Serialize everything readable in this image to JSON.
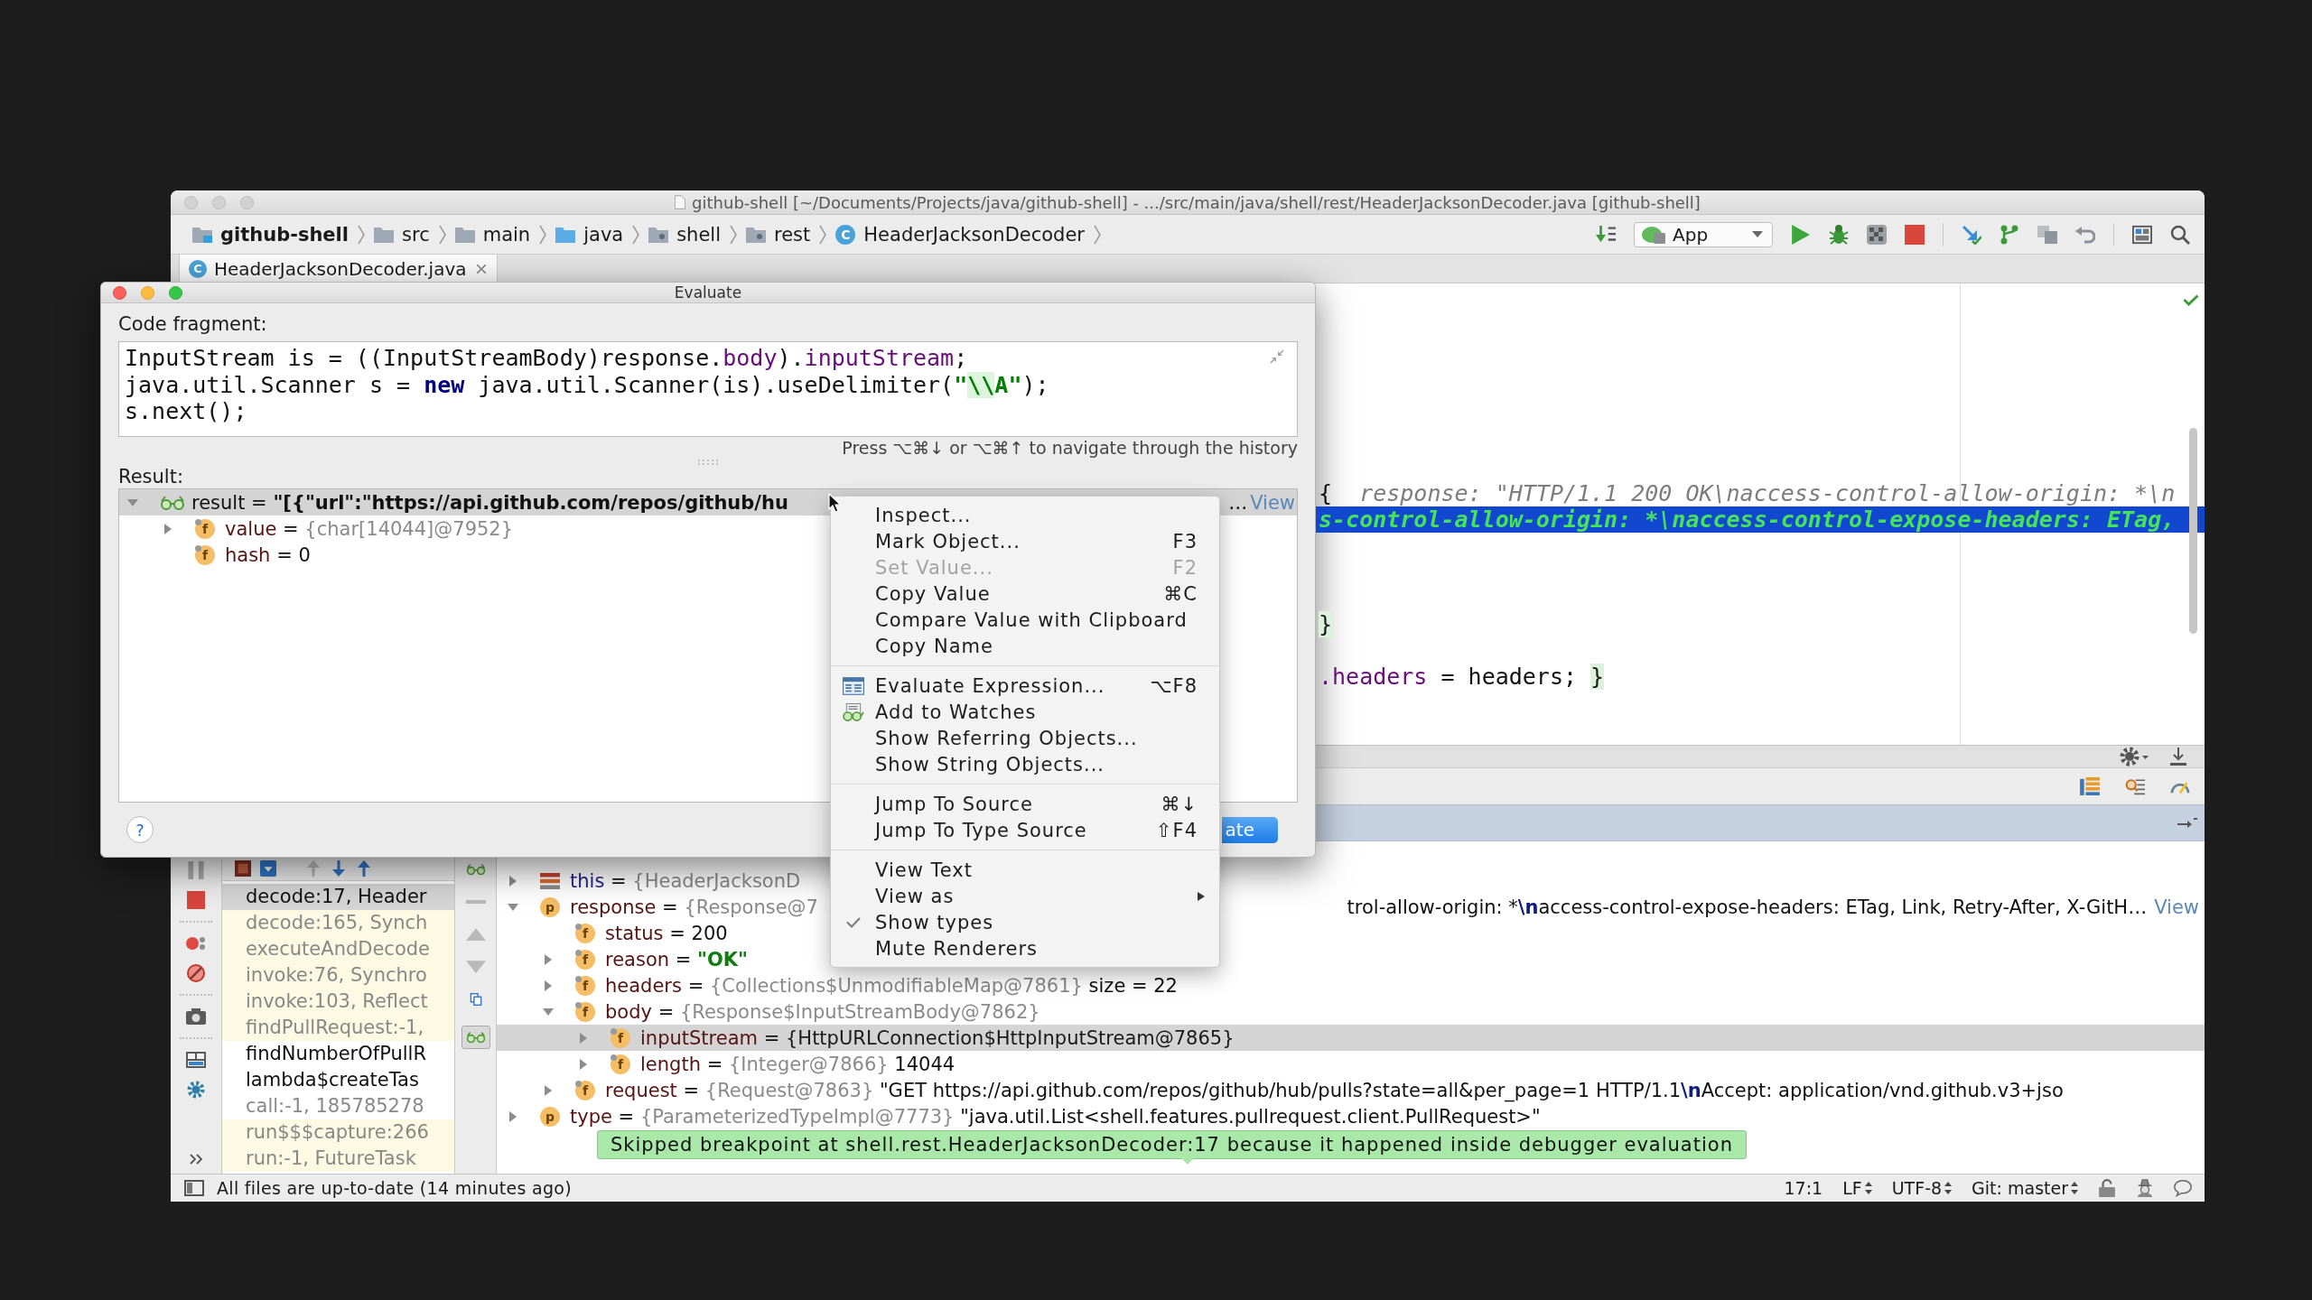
{
  "window": {
    "title": "github-shell [~/Documents/Projects/java/github-shell] - .../src/main/java/shell/rest/HeaderJacksonDecoder.java [github-shell]"
  },
  "navigation_bar": {
    "breadcrumbs": [
      {
        "label": "github-shell",
        "kind": "project"
      },
      {
        "label": "src",
        "kind": "folder"
      },
      {
        "label": "main",
        "kind": "folder"
      },
      {
        "label": "java",
        "kind": "source-root"
      },
      {
        "label": "shell",
        "kind": "package"
      },
      {
        "label": "rest",
        "kind": "package"
      },
      {
        "label": "HeaderJacksonDecoder",
        "kind": "class",
        "icon_letter": "C"
      }
    ],
    "run_configuration": "App"
  },
  "tabs": [
    {
      "label": "HeaderJacksonDecoder.java",
      "icon_letter": "C",
      "selected": true
    }
  ],
  "editor": {
    "lines": [
      {
        "current": false,
        "tokens": [
          {
            "text": "{",
            "kind": "plain"
          },
          {
            "text": "  response: \"HTTP/1.1 200 OK\\naccess-control-allow-origin: *\\n",
            "kind": "hint"
          }
        ]
      },
      {
        "current": true,
        "tokens": [
          {
            "text": "s-control-allow-origin: *\\naccess-control-expose-headers: ETag,",
            "kind": "hint"
          }
        ]
      },
      {
        "current": false,
        "tokens": [
          {
            "text": "}",
            "kind": "match"
          }
        ]
      },
      {
        "current": false,
        "tokens": [
          {
            "text": ".headers",
            "kind": "field"
          },
          {
            "text": " = headers; ",
            "kind": "plain"
          },
          {
            "text": "}",
            "kind": "match"
          }
        ]
      }
    ]
  },
  "evaluate_dialog": {
    "title": "Evaluate",
    "code_label": "Code fragment:",
    "code_lines": [
      {
        "tokens": [
          {
            "text": "InputStream is = ((InputStreamBody)response.",
            "kind": "plain"
          },
          {
            "text": "body",
            "kind": "field"
          },
          {
            "text": ").",
            "kind": "plain"
          },
          {
            "text": "inputStream",
            "kind": "field"
          },
          {
            "text": ";",
            "kind": "plain"
          }
        ]
      },
      {
        "tokens": [
          {
            "text": "java.util.Scanner s = ",
            "kind": "plain"
          },
          {
            "text": "new",
            "kind": "keyword"
          },
          {
            "text": " java.util.Scanner(is).useDelimiter(",
            "kind": "plain"
          },
          {
            "text": "\"",
            "kind": "string"
          },
          {
            "text": "\\\\",
            "kind": "escape"
          },
          {
            "text": "A\"",
            "kind": "string"
          },
          {
            "text": ");",
            "kind": "plain"
          }
        ]
      },
      {
        "tokens": [
          {
            "text": "s.next();",
            "kind": "plain"
          }
        ]
      }
    ],
    "history_hint": "Press ⌥⌘↓ or ⌥⌘↑ to navigate through the history",
    "result_label": "Result:",
    "result_tree": [
      {
        "name": "result",
        "operator": "=",
        "kind": "watch",
        "value": [
          {
            "text": "\"[{\"url\":\"https://api.github.com/repos/github/hu",
            "kind": "strong"
          }
        ],
        "tail": [
          {
            "text": "…",
            "kind": "plain"
          }
        ],
        "link": "View",
        "expandable": true,
        "expanded": true,
        "selected": true,
        "children": [
          {
            "name": "value",
            "operator": "=",
            "kind": "field",
            "icon_letter": "f",
            "type": "{char[14044]@7952}",
            "expandable": true,
            "expanded": false,
            "selected": false
          },
          {
            "name": "hash",
            "operator": "=",
            "kind": "field",
            "icon_letter": "f",
            "value": [
              {
                "text": "0",
                "kind": "plain"
              }
            ],
            "expandable": false,
            "expanded": false,
            "selected": false
          }
        ]
      }
    ],
    "help_button": "?",
    "evaluate_button": "ate"
  },
  "context_menu": {
    "groups": [
      {
        "items": [
          {
            "label": "Inspect...",
            "kind": "plain",
            "disabled": false,
            "checked": false,
            "submenu": false
          },
          {
            "label": "Mark Object...",
            "shortcut": "F3",
            "kind": "plain",
            "disabled": false,
            "checked": false,
            "submenu": false
          },
          {
            "label": "Set Value...",
            "shortcut": "F2",
            "kind": "plain",
            "disabled": true,
            "checked": false,
            "submenu": false
          },
          {
            "label": "Copy Value",
            "shortcut": "⌘C",
            "kind": "plain",
            "disabled": false,
            "checked": false,
            "submenu": false
          },
          {
            "label": "Compare Value with Clipboard",
            "kind": "plain",
            "disabled": false,
            "checked": false,
            "submenu": false
          },
          {
            "label": "Copy Name",
            "kind": "plain",
            "disabled": false,
            "checked": false,
            "submenu": false
          }
        ]
      },
      {
        "items": [
          {
            "label": "Evaluate Expression...",
            "shortcut": "⌥F8",
            "kind": "evaluate",
            "disabled": false,
            "checked": false,
            "submenu": false
          },
          {
            "label": "Add to Watches",
            "kind": "watch",
            "disabled": false,
            "checked": false,
            "submenu": false
          },
          {
            "label": "Show Referring Objects...",
            "kind": "plain",
            "disabled": false,
            "checked": false,
            "submenu": false
          },
          {
            "label": "Show String Objects...",
            "kind": "plain",
            "disabled": false,
            "checked": false,
            "submenu": false
          }
        ]
      },
      {
        "items": [
          {
            "label": "Jump To Source",
            "shortcut": "⌘↓",
            "kind": "plain",
            "disabled": false,
            "checked": false,
            "submenu": false
          },
          {
            "label": "Jump To Type Source",
            "shortcut": "⇧F4",
            "kind": "plain",
            "disabled": false,
            "checked": false,
            "submenu": false
          }
        ]
      },
      {
        "items": [
          {
            "label": "View Text",
            "kind": "plain",
            "disabled": false,
            "checked": false,
            "submenu": false
          },
          {
            "label": "View as",
            "kind": "plain",
            "disabled": false,
            "checked": false,
            "submenu": true
          },
          {
            "label": "Show types",
            "kind": "plain",
            "disabled": false,
            "checked": true,
            "submenu": false
          },
          {
            "label": "Mute Renderers",
            "kind": "plain",
            "disabled": false,
            "checked": false,
            "submenu": false
          }
        ]
      }
    ]
  },
  "debugger": {
    "frames": [
      {
        "label": "decode:17, Header",
        "kind": "user",
        "selected": true
      },
      {
        "label": "decode:165, Synch",
        "kind": "library",
        "selected": false
      },
      {
        "label": "executeAndDecode",
        "kind": "library",
        "selected": false
      },
      {
        "label": "invoke:76, Synchro",
        "kind": "library",
        "selected": false
      },
      {
        "label": "invoke:103, Reflect",
        "kind": "library",
        "selected": false
      },
      {
        "label": "findPullRequest:-1,",
        "kind": "library",
        "selected": false
      },
      {
        "label": "findNumberOfPullR",
        "kind": "user",
        "selected": false
      },
      {
        "label": "lambda$createTas",
        "kind": "user",
        "selected": false
      },
      {
        "label": "call:-1, 185785278",
        "kind": "synthetic",
        "selected": false
      },
      {
        "label": "run$$$capture:266",
        "kind": "library",
        "selected": false
      },
      {
        "label": "run:-1, FutureTask",
        "kind": "library",
        "selected": false
      }
    ],
    "watches_shown": true,
    "variables": [
      {
        "name": "this",
        "operator": "=",
        "kind": "this",
        "type": "{HeaderJacksonD",
        "expandable": true,
        "expanded": false,
        "selected": false
      },
      {
        "name": "response",
        "operator": "=",
        "kind": "parameter",
        "icon_letter": "p",
        "type": "{Response@7",
        "tail": [
          {
            "text": "trol-allow-origin: *",
            "kind": "plain"
          },
          {
            "text": "\\n",
            "kind": "escape"
          },
          {
            "text": "access-control-expose-headers: ETag, Link, Retry-After, X-GitH…",
            "kind": "plain"
          }
        ],
        "link": "View",
        "expandable": true,
        "expanded": true,
        "selected": false,
        "children": [
          {
            "name": "status",
            "operator": "=",
            "kind": "field",
            "icon_letter": "f",
            "value": [
              {
                "text": "200",
                "kind": "plain"
              }
            ],
            "expandable": false,
            "expanded": false,
            "selected": false
          },
          {
            "name": "reason",
            "operator": "=",
            "kind": "field",
            "icon_letter": "f",
            "value": [
              {
                "text": "\"OK\"",
                "kind": "string"
              }
            ],
            "expandable": true,
            "expanded": false,
            "selected": false
          },
          {
            "name": "headers",
            "operator": "=",
            "kind": "field",
            "icon_letter": "f",
            "type": "{Collections$UnmodifiableMap@7861}",
            "value": [
              {
                "text": "size = 22",
                "kind": "plain"
              }
            ],
            "expandable": true,
            "expanded": false,
            "selected": false
          },
          {
            "name": "body",
            "operator": "=",
            "kind": "field",
            "icon_letter": "f",
            "type": "{Response$InputStreamBody@7862}",
            "expandable": true,
            "expanded": true,
            "selected": false,
            "children": [
              {
                "name": "inputStream",
                "operator": "=",
                "kind": "field",
                "icon_letter": "f",
                "type": "{HttpURLConnection$HttpInputStream@7865}",
                "expandable": true,
                "expanded": false,
                "selected": true
              },
              {
                "name": "length",
                "operator": "=",
                "kind": "field",
                "icon_letter": "f",
                "type": "{Integer@7866}",
                "value": [
                  {
                    "text": "14044",
                    "kind": "plain"
                  }
                ],
                "expandable": true,
                "expanded": false,
                "selected": false
              }
            ]
          },
          {
            "name": "request",
            "operator": "=",
            "kind": "field",
            "icon_letter": "f",
            "type": "{Request@7863}",
            "value": [
              {
                "text": "\"GET https://api.github.com/repos/github/hub/pulls?state=all&per_page=1 HTTP/1.1",
                "kind": "plain"
              },
              {
                "text": "\\n",
                "kind": "escape"
              },
              {
                "text": "Accept: application/vnd.github.v3+jso",
                "kind": "plain"
              }
            ],
            "expandable": true,
            "expanded": false,
            "selected": false
          }
        ]
      },
      {
        "name": "type",
        "operator": "=",
        "kind": "parameter",
        "icon_letter": "p",
        "type": "{ParameterizedTypeImpl@7773}",
        "value": [
          {
            "text": "\"java.util.List<shell.features.pullrequest.client.PullRequest>\"",
            "kind": "plain"
          }
        ],
        "expandable": true,
        "expanded": false,
        "selected": false
      }
    ],
    "notification": "Skipped breakpoint at shell.rest.HeaderJacksonDecoder:17 because it happened inside debugger evaluation"
  },
  "status_bar": {
    "message": "All files are up-to-date (14 minutes ago)",
    "position": "17:1",
    "line_separator": "LF",
    "encoding": "UTF-8",
    "vcs_branch": "Git: master"
  }
}
